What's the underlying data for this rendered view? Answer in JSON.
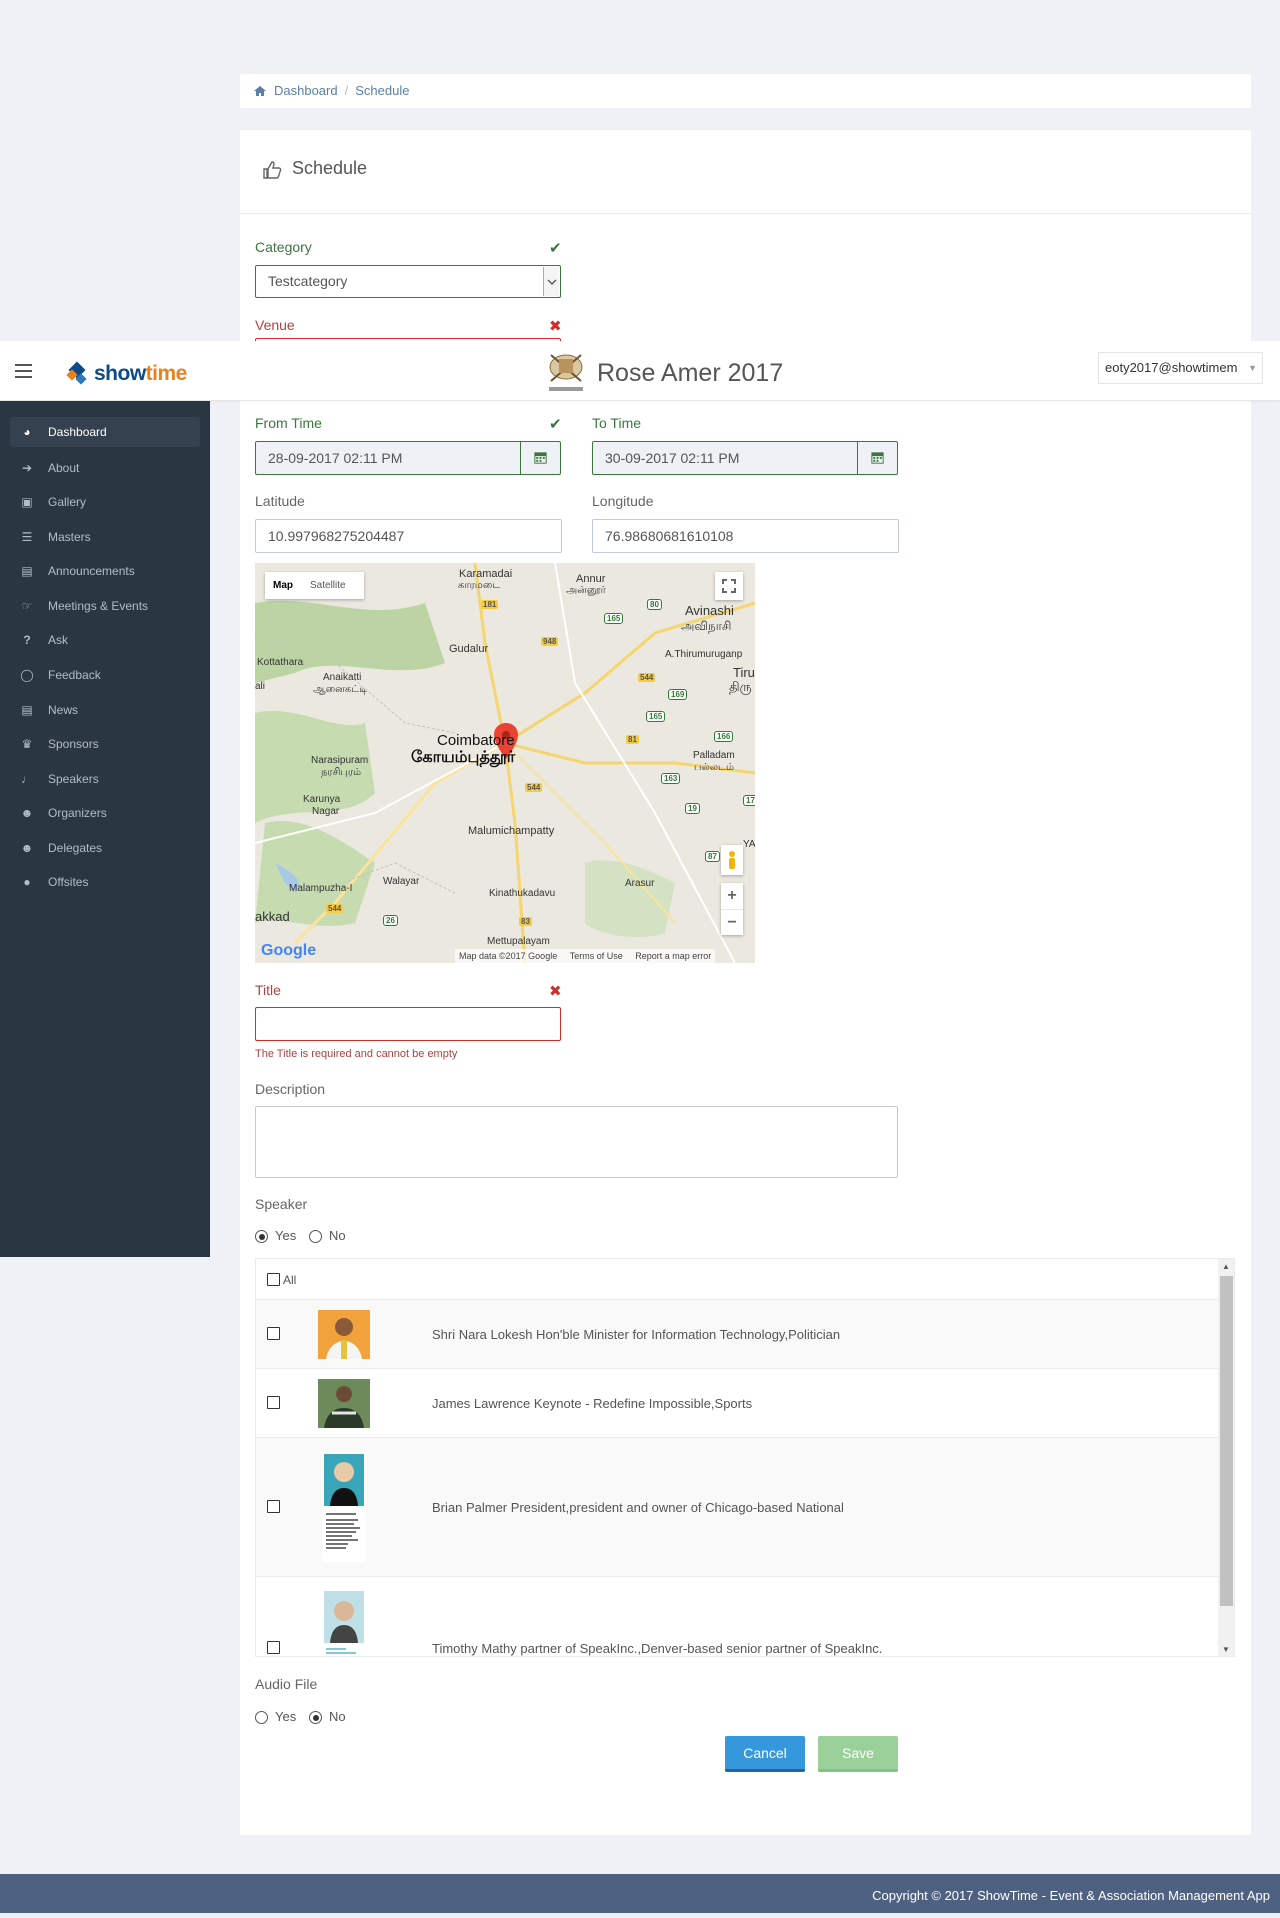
{
  "breadcrumb": {
    "home": "Dashboard",
    "current": "Schedule"
  },
  "page_title": "Schedule",
  "header": {
    "brand_prefix": "show",
    "brand_suffix": "time",
    "event_title": "Rose Amer 2017",
    "user": "eoty2017@showtimem"
  },
  "sidebar": {
    "items": [
      {
        "label": "Dashboard",
        "icon": "dashboard-icon"
      },
      {
        "label": "About",
        "icon": "about-icon"
      },
      {
        "label": "Gallery",
        "icon": "gallery-icon"
      },
      {
        "label": "Masters",
        "icon": "masters-icon"
      },
      {
        "label": "Announcements",
        "icon": "announcements-icon"
      },
      {
        "label": "Meetings & Events",
        "icon": "meetings-icon"
      },
      {
        "label": "Ask",
        "icon": "question-icon"
      },
      {
        "label": "Feedback",
        "icon": "feedback-icon"
      },
      {
        "label": "News",
        "icon": "news-icon"
      },
      {
        "label": "Sponsors",
        "icon": "trophy-icon"
      },
      {
        "label": "Speakers",
        "icon": "microphone-icon"
      },
      {
        "label": "Organizers",
        "icon": "users-icon"
      },
      {
        "label": "Delegates",
        "icon": "users-icon"
      },
      {
        "label": "Offsites",
        "icon": "map-pin-icon"
      }
    ]
  },
  "form": {
    "category": {
      "label": "Category",
      "value": "Testcategory"
    },
    "venue": {
      "label": "Venue"
    },
    "from_time": {
      "label": "From Time",
      "value": "28-09-2017 02:11 PM"
    },
    "to_time": {
      "label": "To Time",
      "value": "30-09-2017 02:11 PM"
    },
    "latitude": {
      "label": "Latitude",
      "value": "10.997968275204487"
    },
    "longitude": {
      "label": "Longitude",
      "value": "76.98680681610108"
    },
    "title": {
      "label": "Title",
      "value": "",
      "error": "The Title is required and cannot be empty"
    },
    "description": {
      "label": "Description",
      "value": ""
    },
    "speaker": {
      "label": "Speaker",
      "yes": "Yes",
      "no": "No",
      "selected": "Yes"
    },
    "audio": {
      "label": "Audio File",
      "yes": "Yes",
      "no": "No",
      "selected": "No"
    },
    "cancel": "Cancel",
    "save": "Save"
  },
  "map": {
    "tab_map": "Map",
    "tab_satellite": "Satellite",
    "labels": {
      "karamadai": "Karamadai",
      "karamadai_ta": "காரமடை",
      "annur": "Annur",
      "annur_ta": "அன்னூர்",
      "avinashi": "Avinashi",
      "avinashi_ta": "அவிநாசி",
      "gudalur": "Gudalur",
      "thirumurugan": "A.Thirumuruganp",
      "tiru": "Tiru",
      "tiru_ta": "திரு",
      "kottathara": "Kottathara",
      "anaikatti": "Anaikatti",
      "anaikatti_ta": "ஆனைகட்டி",
      "ali": "ali",
      "coimbatore": "Coimbatore",
      "coimbatore_ta": "கோயம்புத்தூர்",
      "narasipuram": "Narasipuram",
      "narasipuram_ta": "நரசிபுரம்",
      "karunya": "Karunya",
      "nagar": "Nagar",
      "palladam": "Palladam",
      "palladam_ta": "பல்லடம்",
      "malumichampatty": "Malumichampatty",
      "malampuzha": "Malampuzha-I",
      "walayar": "Walayar",
      "kinathukadavu": "Kinathukadavu",
      "arasur": "Arasur",
      "akkad": "akkad",
      "mettupalayam": "Mettupalayam",
      "ya": "YA"
    },
    "shields": [
      "181",
      "948",
      "80",
      "165",
      "544",
      "169",
      "165",
      "81",
      "166",
      "163",
      "544",
      "19",
      "17",
      "544",
      "26",
      "83",
      "87"
    ],
    "attribution": "Map data ©2017 Google",
    "terms": "Terms of Use",
    "report": "Report a map error",
    "google": "Google"
  },
  "speakers_table": {
    "all_label": "All",
    "rows": [
      {
        "name": "Shri Nara Lokesh Hon'ble Minister for Information Technology,Politician"
      },
      {
        "name": "James Lawrence Keynote - Redefine Impossible,Sports"
      },
      {
        "name": "Brian Palmer President,president and owner of Chicago-based National"
      },
      {
        "name": "Timothy Mathy partner of SpeakInc.,Denver-based senior partner of SpeakInc."
      }
    ]
  },
  "footer": "Copyright © 2017 ShowTime - Event & Association Management App",
  "colors": {
    "success": "#3c763d",
    "error": "#a94442",
    "sidebar": "#2b3643",
    "primary": "#3598dc",
    "save": "#9ad19a",
    "footer": "#4f6181"
  }
}
